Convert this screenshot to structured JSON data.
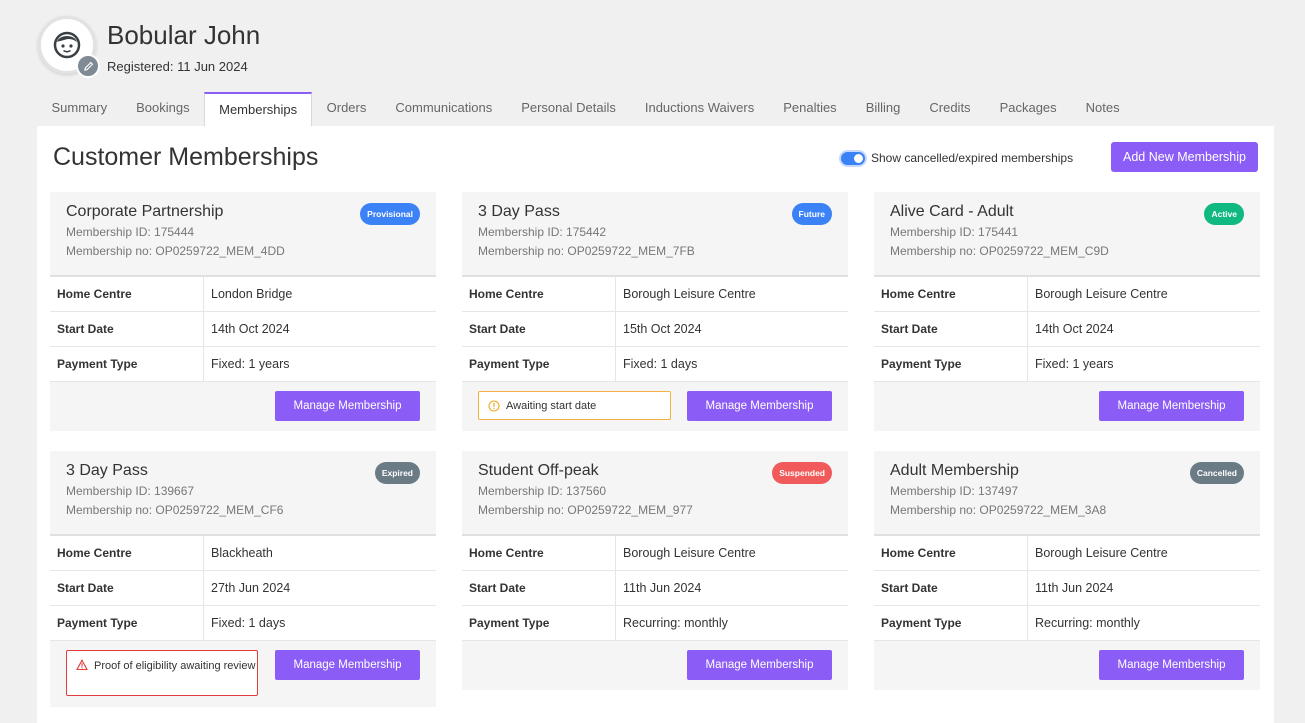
{
  "user": {
    "name": "Bobular John",
    "registered": "Registered: 11 Jun 2024"
  },
  "tabs": [
    {
      "label": "Summary"
    },
    {
      "label": "Bookings"
    },
    {
      "label": "Memberships",
      "active": true
    },
    {
      "label": "Orders"
    },
    {
      "label": "Communications"
    },
    {
      "label": "Personal Details"
    },
    {
      "label": "Inductions Waivers"
    },
    {
      "label": "Penalties"
    },
    {
      "label": "Billing"
    },
    {
      "label": "Credits"
    },
    {
      "label": "Packages"
    },
    {
      "label": "Notes"
    }
  ],
  "page": {
    "title": "Customer Memberships",
    "toggle_label": "Show cancelled/expired memberships",
    "toggle_on": true,
    "add_button": "Add New Membership"
  },
  "colors": {
    "accent": "#8b5cf6",
    "provisional": "#3b82f6",
    "future": "#3b82f6",
    "active": "#10b981",
    "expired": "#6b7b86",
    "suspended": "#f05a5a",
    "cancelled": "#6b7b86"
  },
  "labels": {
    "home_centre": "Home Centre",
    "start_date": "Start Date",
    "payment_type": "Payment Type",
    "manage": "Manage Membership"
  },
  "memberships": [
    {
      "title": "Corporate Partnership",
      "id": "Membership ID: 175444",
      "no": "Membership no: OP0259722_MEM_4DD",
      "status": "Provisional",
      "home_centre": "London Bridge",
      "start_date": "14th Oct 2024",
      "payment_type": "Fixed: 1 years"
    },
    {
      "title": "3 Day Pass",
      "id": "Membership ID: 175442",
      "no": "Membership no: OP0259722_MEM_7FB",
      "status": "Future",
      "home_centre": "Borough Leisure Centre",
      "start_date": "15th Oct 2024",
      "payment_type": "Fixed: 1 days",
      "notice": "Awaiting start date"
    },
    {
      "title": "Alive Card - Adult",
      "id": "Membership ID: 175441",
      "no": "Membership no: OP0259722_MEM_C9D",
      "status": "Active",
      "home_centre": "Borough Leisure Centre",
      "start_date": "14th Oct 2024",
      "payment_type": "Fixed: 1 years"
    },
    {
      "title": "3 Day Pass",
      "id": "Membership ID: 139667",
      "no": "Membership no: OP0259722_MEM_CF6",
      "status": "Expired",
      "home_centre": "Blackheath",
      "start_date": "27th Jun 2024",
      "payment_type": "Fixed: 1 days",
      "error": "Proof of eligibility awaiting review"
    },
    {
      "title": "Student Off-peak",
      "id": "Membership ID: 137560",
      "no": "Membership no: OP0259722_MEM_977",
      "status": "Suspended",
      "home_centre": "Borough Leisure Centre",
      "start_date": "11th Jun 2024",
      "payment_type": "Recurring: monthly"
    },
    {
      "title": "Adult Membership",
      "id": "Membership ID: 137497",
      "no": "Membership no: OP0259722_MEM_3A8",
      "status": "Cancelled",
      "home_centre": "Borough Leisure Centre",
      "start_date": "11th Jun 2024",
      "payment_type": "Recurring: monthly"
    }
  ]
}
